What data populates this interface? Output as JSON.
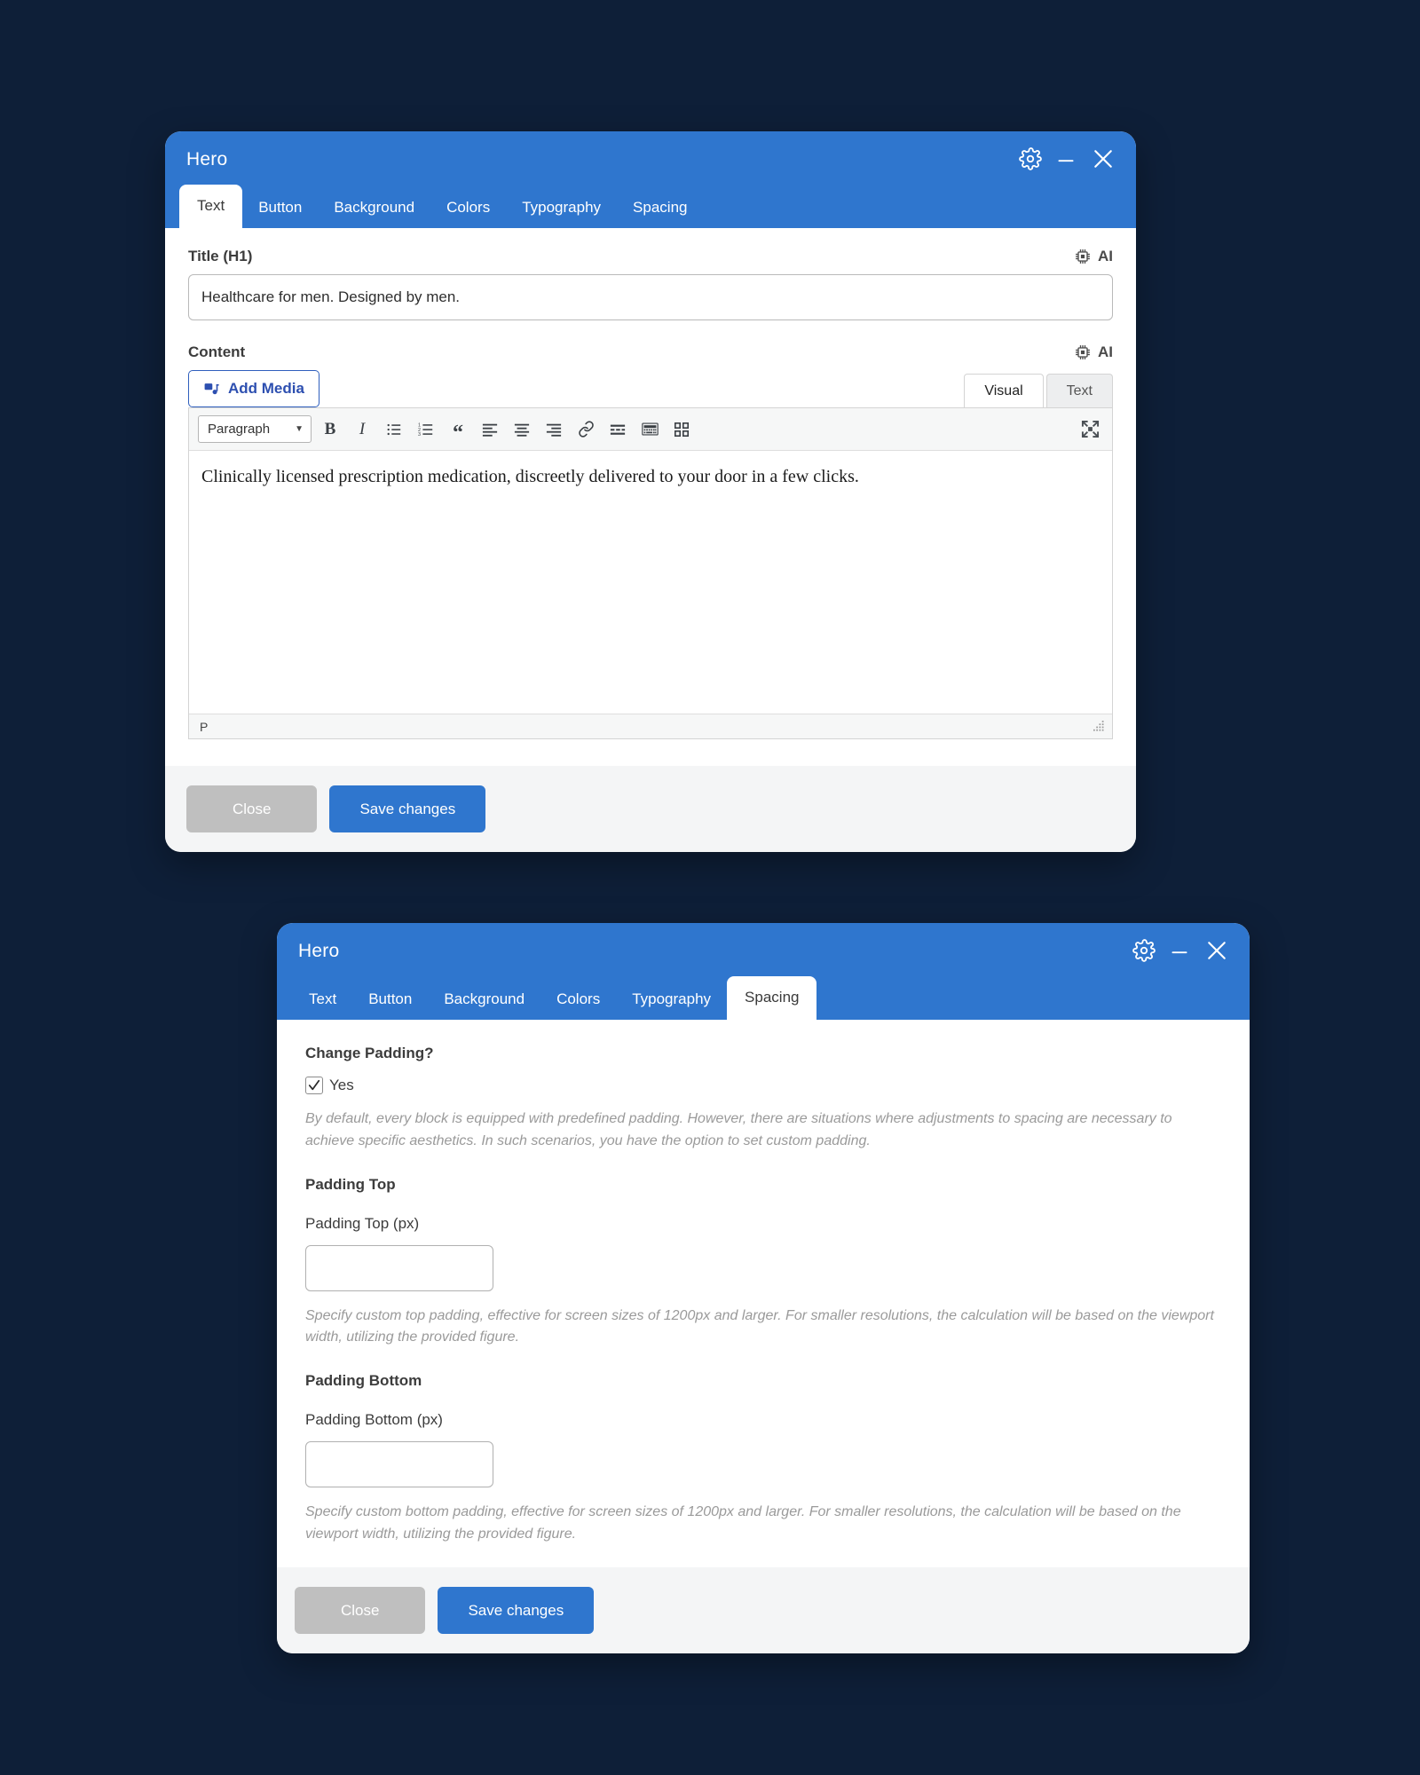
{
  "theme": {
    "page_background": "#0e1f38",
    "header_blue": "#2f76ce",
    "primary_button": "#2f76ce",
    "secondary_button": "#bfbfbf",
    "footer_background": "#f4f5f6"
  },
  "modal_text": {
    "title": "Hero",
    "window_controls": [
      {
        "name": "gear-icon",
        "label": "Settings"
      },
      {
        "name": "minimize-icon",
        "label": "Minimize"
      },
      {
        "name": "close-icon",
        "label": "Close"
      }
    ],
    "tabs": [
      {
        "label": "Text",
        "active": true
      },
      {
        "label": "Button",
        "active": false
      },
      {
        "label": "Background",
        "active": false
      },
      {
        "label": "Colors",
        "active": false
      },
      {
        "label": "Typography",
        "active": false
      },
      {
        "label": "Spacing",
        "active": false
      }
    ],
    "title_field": {
      "label": "Title (H1)",
      "value": "Healthcare for men. Designed by men.",
      "placeholder": "",
      "ai_label": "AI"
    },
    "content_field": {
      "label": "Content",
      "ai_label": "AI",
      "add_media_label": "Add Media",
      "editor_tabs": [
        {
          "label": "Visual",
          "active": true
        },
        {
          "label": "Text",
          "active": false
        }
      ],
      "format_select": {
        "value": "Paragraph",
        "caret": "▼"
      },
      "toolbar_buttons": [
        {
          "name": "bold",
          "glyph": "B"
        },
        {
          "name": "italic",
          "glyph": "I"
        },
        {
          "name": "bulleted-list",
          "glyph": ""
        },
        {
          "name": "numbered-list",
          "glyph": ""
        },
        {
          "name": "blockquote",
          "glyph": "“"
        },
        {
          "name": "align-left",
          "glyph": ""
        },
        {
          "name": "align-center",
          "glyph": ""
        },
        {
          "name": "align-right",
          "glyph": ""
        },
        {
          "name": "insert-link",
          "glyph": ""
        },
        {
          "name": "read-more",
          "glyph": ""
        },
        {
          "name": "toolbar-toggle",
          "glyph": ""
        },
        {
          "name": "blocks-grid",
          "glyph": ""
        },
        {
          "name": "fullscreen",
          "glyph": ""
        }
      ],
      "body_text": "Clinically licensed prescription medication, discreetly delivered to your door in a few clicks.",
      "status_path": "P"
    },
    "footer": {
      "close_label": "Close",
      "save_label": "Save changes"
    }
  },
  "modal_spacing": {
    "title": "Hero",
    "window_controls": [
      {
        "name": "gear-icon",
        "label": "Settings"
      },
      {
        "name": "minimize-icon",
        "label": "Minimize"
      },
      {
        "name": "close-icon",
        "label": "Close"
      }
    ],
    "tabs": [
      {
        "label": "Text",
        "active": false
      },
      {
        "label": "Button",
        "active": false
      },
      {
        "label": "Background",
        "active": false
      },
      {
        "label": "Colors",
        "active": false
      },
      {
        "label": "Typography",
        "active": false
      },
      {
        "label": "Spacing",
        "active": true
      }
    ],
    "change_padding": {
      "heading": "Change Padding?",
      "checkbox_label": "Yes",
      "checkbox_checked": true,
      "description": "By default, every block is equipped with predefined padding. However, there are situations where adjustments to spacing are necessary to achieve specific aesthetics. In such scenarios, you have the option to set custom padding."
    },
    "padding_top": {
      "section_title": "Padding Top",
      "field_label": "Padding Top (px)",
      "value": "",
      "placeholder": "",
      "description": "Specify custom top padding, effective for screen sizes of 1200px and larger. For smaller resolutions, the calculation will be based on the viewport width, utilizing the provided figure."
    },
    "padding_bottom": {
      "section_title": "Padding Bottom",
      "field_label": "Padding Bottom (px)",
      "value": "",
      "placeholder": "",
      "description": "Specify custom bottom padding, effective for screen sizes of 1200px and larger. For smaller resolutions, the calculation will be based on the viewport width, utilizing the provided figure."
    },
    "footer": {
      "close_label": "Close",
      "save_label": "Save changes"
    }
  }
}
